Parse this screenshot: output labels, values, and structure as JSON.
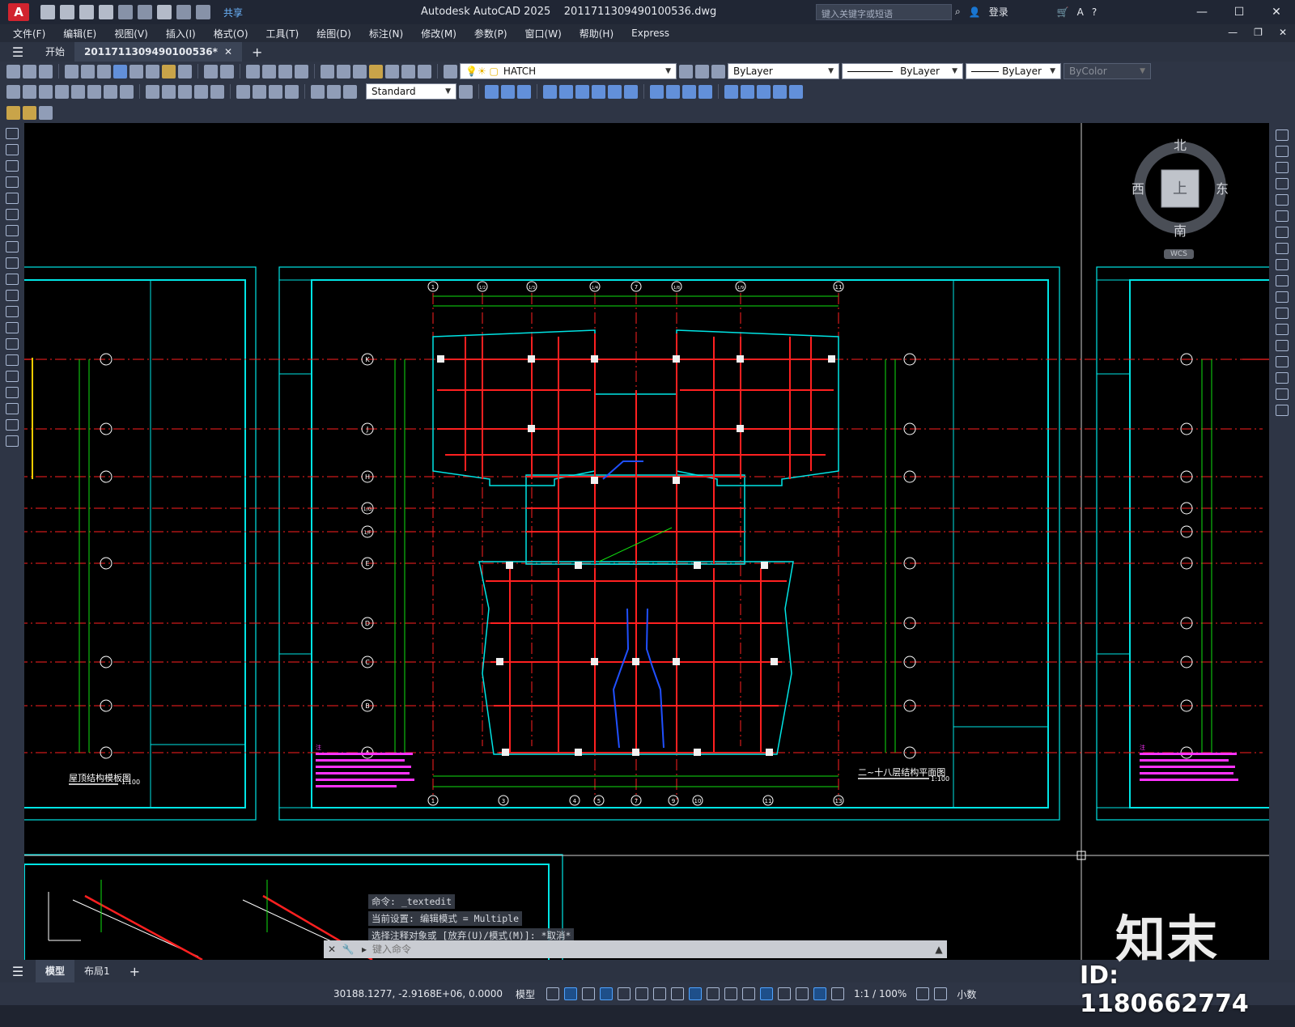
{
  "app": {
    "logo": "A",
    "title": "Autodesk AutoCAD 2025",
    "filename": "20117113094901005 36.dwg",
    "share_label": "共享",
    "search_placeholder": "键入关键字或短语",
    "login_label": "登录"
  },
  "menu": [
    "文件(F)",
    "编辑(E)",
    "视图(V)",
    "插入(I)",
    "格式(O)",
    "工具(T)",
    "绘图(D)",
    "标注(N)",
    "修改(M)",
    "参数(P)",
    "窗口(W)",
    "帮助(H)",
    "Express"
  ],
  "file_tabs": {
    "start": "开始",
    "active": "2011711309490100536*"
  },
  "toolbar": {
    "layer_name": "HATCH",
    "color": "ByLayer",
    "linetype": "ByLayer",
    "lineweight": "ByLayer",
    "plotstyle": "ByColor",
    "dim_style": "Standard"
  },
  "viewcube": {
    "north": "北",
    "south": "南",
    "east": "东",
    "west": "西",
    "face": "上",
    "ucs": "WCS"
  },
  "drawing": {
    "center_title": "二~十八层结构平面图",
    "center_scale": "1:100",
    "left_title": "屋顶结构模板图",
    "left_scale": "1:100",
    "top_axes": [
      "1",
      "1/2",
      "1/3",
      "1/4",
      "7",
      "1/8",
      "1/9",
      "11"
    ],
    "bottom_axes": [
      "1",
      "3",
      "4",
      "5",
      "7",
      "9",
      "10",
      "11",
      "13"
    ],
    "row_axes": [
      "K",
      "J",
      "H",
      "1/G",
      "1/F",
      "E",
      "D",
      "C",
      "B",
      "A"
    ],
    "notes_label": "注"
  },
  "command": {
    "history": [
      "命令: _textedit",
      "当前设置: 编辑模式 = Multiple",
      "选择注释对象或 [放弃(U)/模式(M)]: *取消*"
    ],
    "placeholder": "键入命令"
  },
  "layout_tabs": [
    "模型",
    "布局1"
  ],
  "status": {
    "coords": "30188.1277, -2.9168E+06, 0.0000",
    "space": "模型",
    "scale": "1:1 / 100%",
    "units": "小数"
  },
  "watermark": {
    "brand": "知末",
    "id": "ID: 1180662774"
  },
  "colors": {
    "canvas": "#000000",
    "frame": "#00e5e5",
    "axis_red": "#ff2020",
    "magenta": "#ff33ff",
    "green": "#10e010"
  }
}
